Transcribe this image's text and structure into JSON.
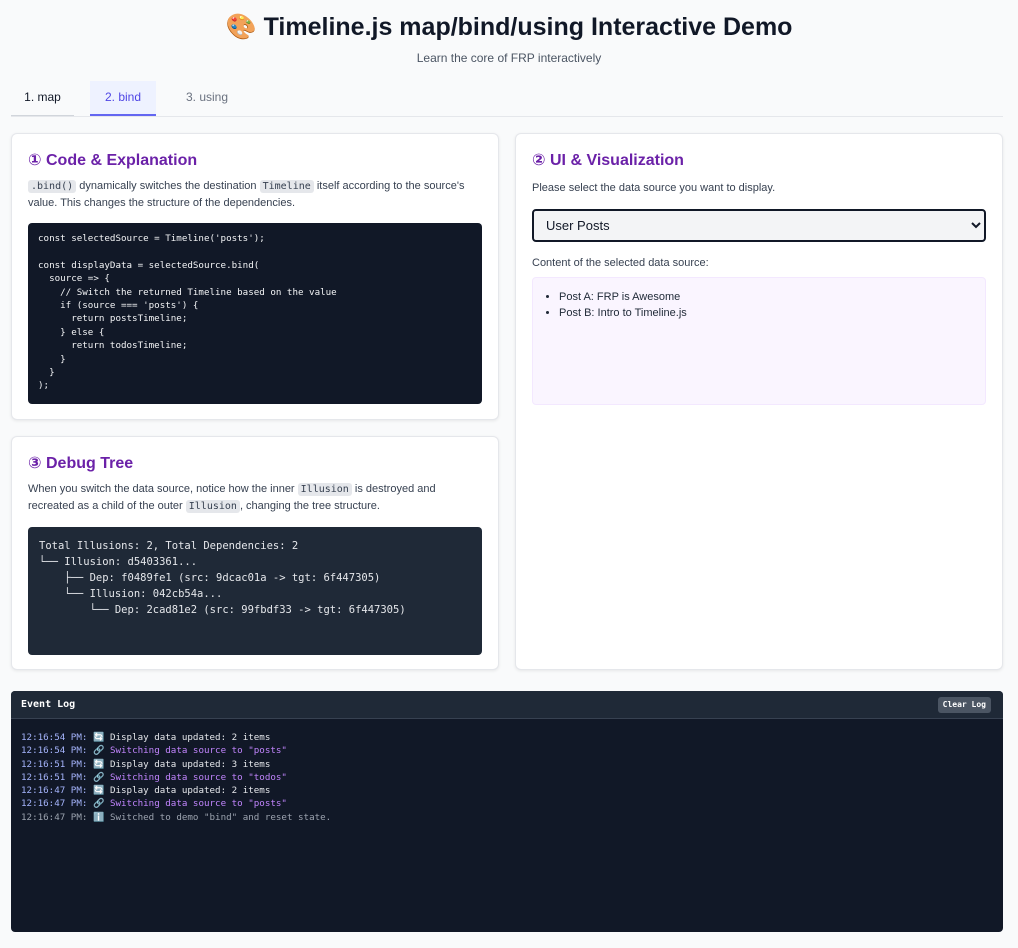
{
  "header": {
    "title": "🎨 Timeline.js map/bind/using Interactive Demo",
    "subtitle": "Learn the core of FRP interactively"
  },
  "tabs": [
    {
      "label": "1. map",
      "active": false
    },
    {
      "label": "2. bind",
      "active": true
    },
    {
      "label": "3. using",
      "active": false
    }
  ],
  "code_panel": {
    "title": "① Code & Explanation",
    "desc_code1": ".bind()",
    "desc_text1": " dynamically switches the destination ",
    "desc_code2": "Timeline",
    "desc_text2": " itself according to the source's value. This changes the structure of the dependencies.",
    "code": "const selectedSource = Timeline('posts');\n\nconst displayData = selectedSource.bind(\n  source => {\n    // Switch the returned Timeline based on the value\n    if (source === 'posts') {\n      return postsTimeline;\n    } else {\n      return todosTimeline;\n    }\n  }\n);"
  },
  "debug_panel": {
    "title": "③ Debug Tree",
    "desc_text1": "When you switch the data source, notice how the inner ",
    "desc_code1": "Illusion",
    "desc_text2": " is destroyed and recreated as a child of the outer ",
    "desc_code2": "Illusion",
    "desc_text3": ", changing the tree structure.",
    "tree": "Total Illusions: 2, Total Dependencies: 2\n└── Illusion: d5403361...\n    ├── Dep: f0489fe1 (src: 9dcac01a -> tgt: 6f447305)\n    └── Illusion: 042cb54a...\n        └── Dep: 2cad81e2 (src: 99fbdf33 -> tgt: 6f447305)"
  },
  "ui_panel": {
    "title": "② UI & Visualization",
    "prompt": "Please select the data source you want to display.",
    "selected": "User Posts",
    "content_label": "Content of the selected data source:",
    "items": [
      "Post A: FRP is Awesome",
      "Post B: Intro to Timeline.js"
    ]
  },
  "event_log": {
    "title": "Event Log",
    "clear_label": "Clear Log",
    "entries": [
      {
        "time": "12:16:54 PM:",
        "icon": "🔄",
        "text": "Display data updated: 2 items",
        "kind": "update"
      },
      {
        "time": "12:16:54 PM:",
        "icon": "🔗",
        "text": "Switching data source to \"posts\"",
        "kind": "switch"
      },
      {
        "time": "12:16:51 PM:",
        "icon": "🔄",
        "text": "Display data updated: 3 items",
        "kind": "update"
      },
      {
        "time": "12:16:51 PM:",
        "icon": "🔗",
        "text": "Switching data source to \"todos\"",
        "kind": "switch"
      },
      {
        "time": "12:16:47 PM:",
        "icon": "🔄",
        "text": "Display data updated: 2 items",
        "kind": "update"
      },
      {
        "time": "12:16:47 PM:",
        "icon": "🔗",
        "text": "Switching data source to \"posts\"",
        "kind": "switch"
      },
      {
        "time": "12:16:47 PM:",
        "icon": "ℹ️",
        "text": "Switched to demo \"bind\" and reset state.",
        "kind": "info"
      }
    ]
  }
}
